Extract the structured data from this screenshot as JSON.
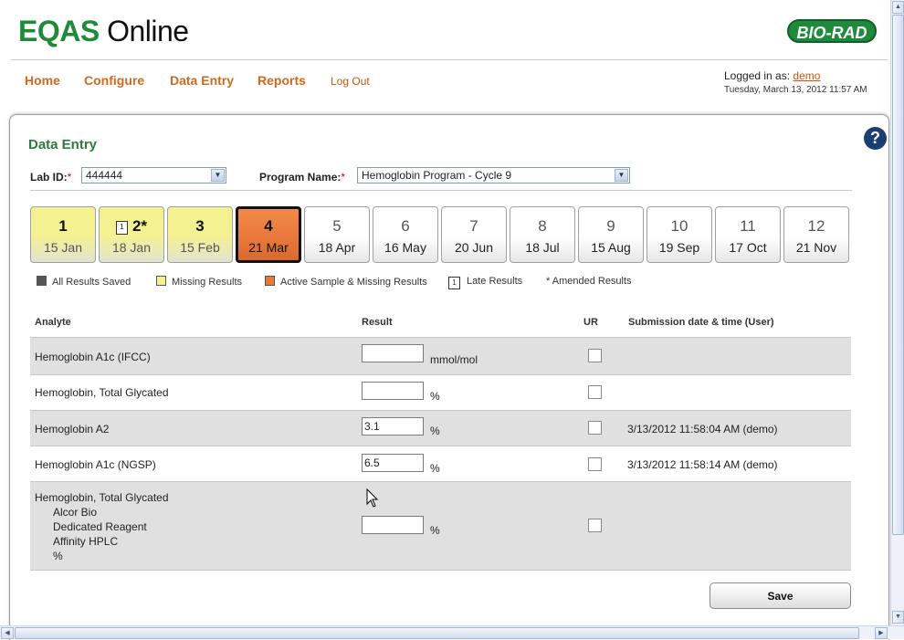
{
  "header": {
    "logo_bold": "EQAS",
    "logo_light": " Online",
    "brand": "BIO-RAD"
  },
  "nav": [
    {
      "label": "Home"
    },
    {
      "label": "Configure"
    },
    {
      "label": "Data Entry"
    },
    {
      "label": "Reports"
    },
    {
      "label": "Log Out"
    }
  ],
  "login": {
    "prefix": "Logged in as: ",
    "user": "demo",
    "datetime": "Tuesday, March 13, 2012 11:57 AM"
  },
  "page": {
    "title": "Data Entry",
    "help": "?"
  },
  "form": {
    "lab_label": "Lab ID:",
    "lab_required": "*",
    "lab_value": "444444",
    "program_label": "Program Name:",
    "program_required": "*",
    "program_value": "Hemoglobin Program - Cycle 9"
  },
  "samples": [
    {
      "num": "1",
      "date": "15 Jan",
      "status": "missing"
    },
    {
      "num": "2*",
      "date": "18 Jan",
      "status": "missing",
      "late": true,
      "late_mark": "1"
    },
    {
      "num": "3",
      "date": "15 Feb",
      "status": "missing"
    },
    {
      "num": "4",
      "date": "21 Mar",
      "status": "active"
    },
    {
      "num": "5",
      "date": "18 Apr",
      "status": "default"
    },
    {
      "num": "6",
      "date": "16 May",
      "status": "default"
    },
    {
      "num": "7",
      "date": "20 Jun",
      "status": "default"
    },
    {
      "num": "8",
      "date": "18 Jul",
      "status": "default"
    },
    {
      "num": "9",
      "date": "15 Aug",
      "status": "default"
    },
    {
      "num": "10",
      "date": "19 Sep",
      "status": "default"
    },
    {
      "num": "11",
      "date": "17 Oct",
      "status": "default"
    },
    {
      "num": "12",
      "date": "21 Nov",
      "status": "default"
    }
  ],
  "legend": {
    "saved": "All Results Saved",
    "missing": "Missing Results",
    "active": "Active Sample & Missing Results",
    "late_mark": "1",
    "late": "Late Results",
    "amended": "* Amended Results",
    "colors": {
      "saved": "#555555",
      "missing": "#f4f290",
      "active": "#e8773a"
    }
  },
  "table": {
    "headers": {
      "analyte": "Analyte",
      "result": "Result",
      "ur": "UR",
      "submission": "Submission date & time (User)"
    },
    "rows": [
      {
        "analyte": "Hemoglobin A1c (IFCC)",
        "value": "",
        "unit": "mmol/mol",
        "submission": ""
      },
      {
        "analyte": "Hemoglobin, Total Glycated",
        "value": "",
        "unit": "%",
        "submission": ""
      },
      {
        "analyte": "Hemoglobin A2",
        "value": "3.1",
        "unit": "%",
        "submission": "3/13/2012 11:58:04 AM (demo)"
      },
      {
        "analyte": "Hemoglobin A1c (NGSP)",
        "value": "6.5",
        "unit": "%",
        "submission": "3/13/2012 11:58:14 AM (demo)"
      },
      {
        "analyte": "Hemoglobin, Total Glycated",
        "details": [
          "Alcor Bio",
          "Dedicated Reagent",
          "Affinity HPLC",
          "%"
        ],
        "value": "",
        "unit": "%",
        "submission": ""
      }
    ]
  },
  "actions": {
    "save": "Save"
  },
  "scrollbars": {
    "up": "▲",
    "down": "▼",
    "left": "◀",
    "right": "▶"
  }
}
